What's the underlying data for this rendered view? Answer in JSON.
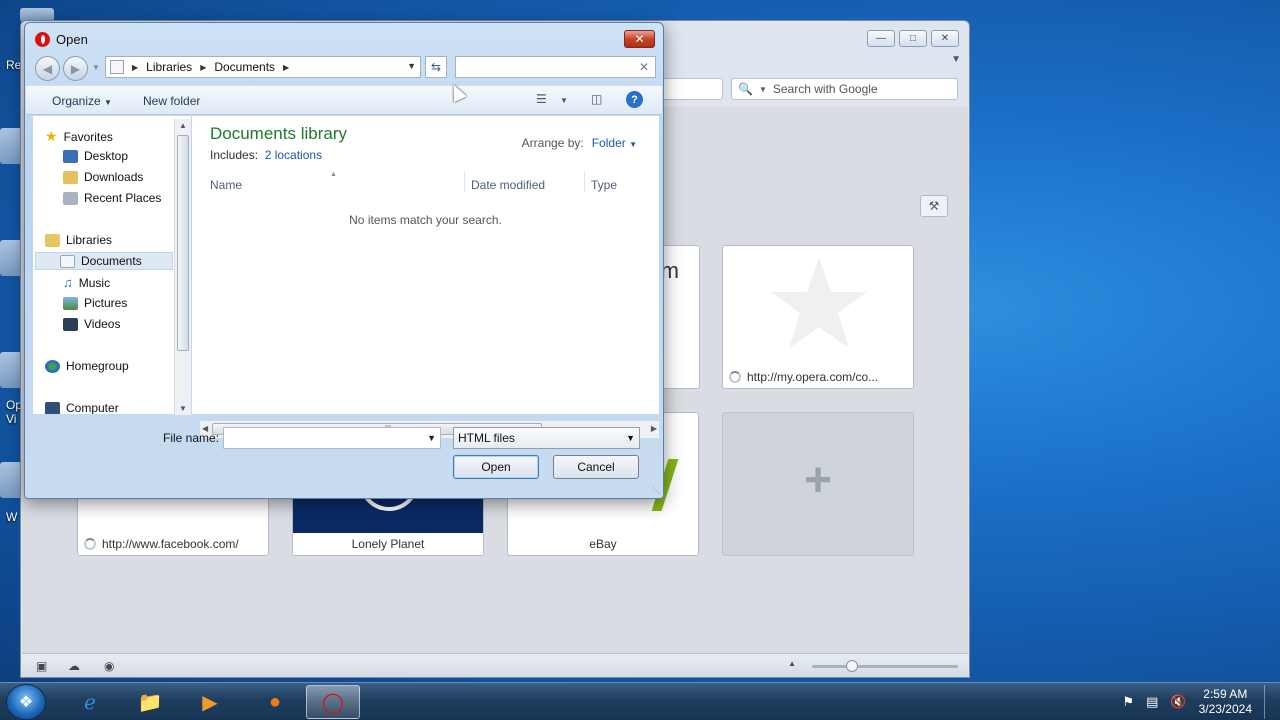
{
  "desktop": {
    "icon_labels": [
      "Re",
      "Op",
      "Vi",
      "W"
    ]
  },
  "opera": {
    "search_placeholder": "Search with Google",
    "speed_dial": [
      {
        "label": "http://my.opera.com/co...",
        "loading": true
      },
      {
        "label": "http://www.facebook.com/",
        "loading": true
      },
      {
        "label": "Lonely Planet",
        "loading": false
      },
      {
        "label": "eBay",
        "loading": false
      },
      {
        "label": "+",
        "type": "add"
      }
    ]
  },
  "dialog": {
    "title": "Open",
    "breadcrumb": [
      "Libraries",
      "Documents"
    ],
    "search_value": "",
    "toolbar": {
      "organize": "Organize",
      "new_folder": "New folder"
    },
    "nav": {
      "favorites": "Favorites",
      "desktop": "Desktop",
      "downloads": "Downloads",
      "recent_places": "Recent Places",
      "libraries": "Libraries",
      "documents": "Documents",
      "music": "Music",
      "pictures": "Pictures",
      "videos": "Videos",
      "homegroup": "Homegroup",
      "computer": "Computer"
    },
    "library": {
      "title": "Documents library",
      "includes_label": "Includes:",
      "includes_link": "2 locations",
      "arrange_label": "Arrange by:",
      "arrange_value": "Folder"
    },
    "columns": {
      "name": "Name",
      "date_modified": "Date modified",
      "type": "Type"
    },
    "empty_message": "No items match your search.",
    "file_name_label": "File name:",
    "file_name_value": "",
    "file_type": "HTML files",
    "open_button": "Open",
    "cancel_button": "Cancel"
  },
  "taskbar": {
    "time": "2:59 AM",
    "date": "3/23/2024"
  }
}
